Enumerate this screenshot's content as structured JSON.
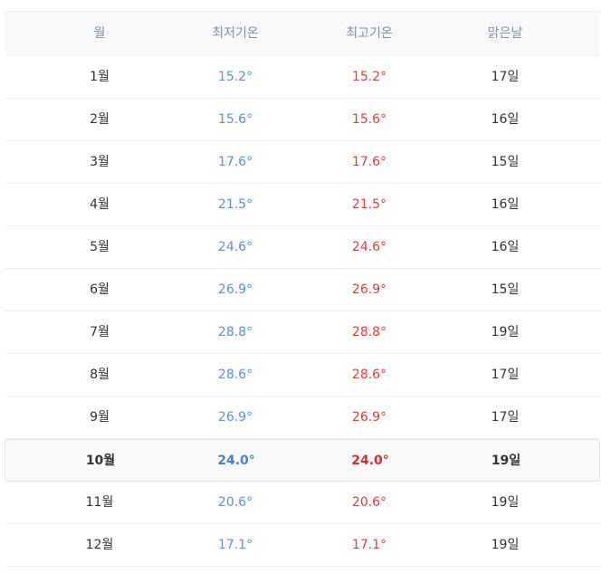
{
  "table": {
    "headers": {
      "month": "월",
      "low": "최저기온",
      "high": "최고기온",
      "sunny": "맑은날"
    },
    "rows": [
      {
        "month": "1월",
        "low": "15.2°",
        "high": "15.2°",
        "sunny": "17일",
        "highlight": false
      },
      {
        "month": "2월",
        "low": "15.6°",
        "high": "15.6°",
        "sunny": "16일",
        "highlight": false
      },
      {
        "month": "3월",
        "low": "17.6°",
        "high": "17.6°",
        "sunny": "15일",
        "highlight": false
      },
      {
        "month": "4월",
        "low": "21.5°",
        "high": "21.5°",
        "sunny": "16일",
        "highlight": false
      },
      {
        "month": "5월",
        "low": "24.6°",
        "high": "24.6°",
        "sunny": "16일",
        "highlight": false
      },
      {
        "month": "6월",
        "low": "26.9°",
        "high": "26.9°",
        "sunny": "15일",
        "highlight": false
      },
      {
        "month": "7월",
        "low": "28.8°",
        "high": "28.8°",
        "sunny": "19일",
        "highlight": false
      },
      {
        "month": "8월",
        "low": "28.6°",
        "high": "28.6°",
        "sunny": "17일",
        "highlight": false
      },
      {
        "month": "9월",
        "low": "26.9°",
        "high": "26.9°",
        "sunny": "17일",
        "highlight": false
      },
      {
        "month": "10월",
        "low": "24.0°",
        "high": "24.0°",
        "sunny": "19일",
        "highlight": true
      },
      {
        "month": "11월",
        "low": "20.6°",
        "high": "20.6°",
        "sunny": "19일",
        "highlight": false
      },
      {
        "month": "12월",
        "low": "17.1°",
        "high": "17.1°",
        "sunny": "19일",
        "highlight": false
      }
    ]
  },
  "colors": {
    "low_temp": "#5b8fe0",
    "high_temp": "#e03b3b",
    "header_text": "#8a8f98",
    "body_text": "#333333"
  }
}
